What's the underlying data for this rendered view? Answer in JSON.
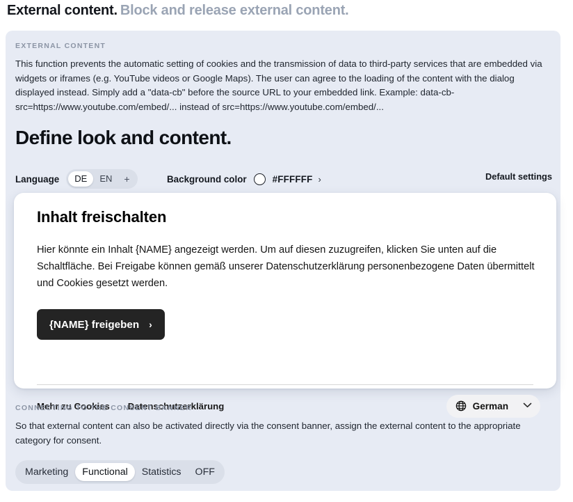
{
  "heading": {
    "lead": "External content.",
    "sub": "Block and release external content."
  },
  "info": {
    "eyebrow": "EXTERNAL CONTENT",
    "body": "This function prevents the automatic setting of cookies and the transmission of data to third-party services that are embedded via widgets or iframes (e.g. YouTube videos or Google Maps). The user can agree to the loading of the content with the dialog displayed instead. Simply add a \"data-cb\" before the source URL to your embedded link. Example: data-cb-src=https://www.youtube.com/embed/... instead of src=https://www.youtube.com/embed/..."
  },
  "section": {
    "title": "Define look and content."
  },
  "controls": {
    "language_label": "Language",
    "language_options": [
      "DE",
      "EN"
    ],
    "language_selected": "DE",
    "language_add": "+",
    "background_label": "Background color",
    "background_value": "#FFFFFF",
    "background_swatch_color": "#FFFFFF",
    "background_chevron": "›",
    "default_settings": "Default settings"
  },
  "card": {
    "title": "Inhalt freischalten",
    "body": "Hier könnte ein Inhalt {NAME} angezeigt werden. Um auf diesen zuzugreifen, klicken Sie unten auf die Schaltfläche. Bei Freigabe können gemäß unserer Datenschutzerklärung personenbezogene Daten übermittelt und Cookies gesetzt werden.",
    "cta_label": "{NAME} freigeben",
    "cta_chevron": "›",
    "cta_background": "#242424",
    "links": [
      "Mehr zu Cookies",
      "Datenschutzerklärung"
    ],
    "language_select": {
      "value": "German",
      "caret": "⌄"
    }
  },
  "connect": {
    "eyebrow": "CONNECTING TO THE CONSENT BANNER",
    "body": "So that external content can also be activated directly via the consent banner, assign the external content to the appropriate category for consent."
  },
  "categories": {
    "options": [
      "Marketing",
      "Functional",
      "Statistics",
      "OFF"
    ],
    "selected": "Functional"
  }
}
